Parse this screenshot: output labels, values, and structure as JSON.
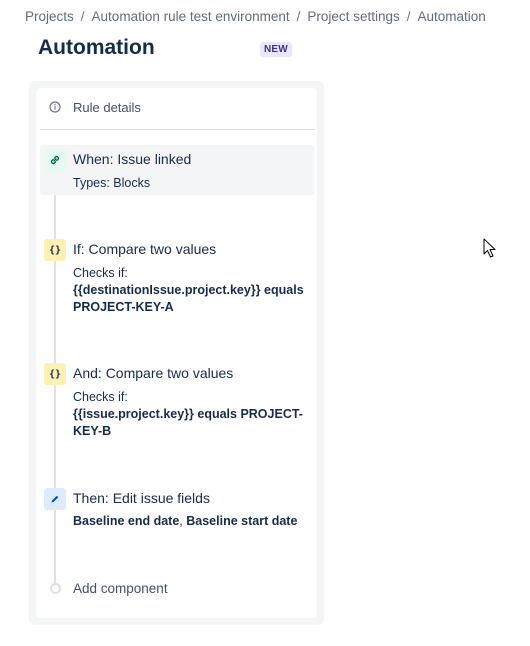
{
  "breadcrumb": {
    "items": [
      "Projects",
      "Automation rule test environment",
      "Project settings",
      "Automation"
    ],
    "separator": "/"
  },
  "page": {
    "title": "Automation",
    "badge": "NEW"
  },
  "rule_details": {
    "label": "Rule details",
    "icon": "info-icon"
  },
  "steps": {
    "trigger": {
      "icon": "link-icon",
      "title": "When: Issue linked",
      "detail": "Types: Blocks"
    },
    "condition1": {
      "icon": "braces-icon",
      "icon_glyph": "{}",
      "title": "If: Compare two values",
      "detail_label": "Checks if:",
      "detail_value": "{{destinationIssue.project.key}} equals PROJECT-KEY-A"
    },
    "condition2": {
      "icon": "braces-icon",
      "icon_glyph": "{}",
      "title": "And: Compare two values",
      "detail_label": "Checks if:",
      "detail_value": "{{issue.project.key}} equals PROJECT-KEY-B"
    },
    "action": {
      "icon": "pencil-icon",
      "title": "Then: Edit issue fields",
      "field1": "Baseline end date",
      "field_sep": ", ",
      "field2": "Baseline start date"
    }
  },
  "add_component": {
    "label": "Add component"
  },
  "colors": {
    "text": "#172b4d",
    "subtle": "#5e6c84",
    "badge_bg": "#eae6ff",
    "badge_text": "#403294",
    "trigger_icon_bg": "#e3fcef",
    "condition_icon_bg": "#fff0b3",
    "action_icon_bg": "#deebff"
  }
}
